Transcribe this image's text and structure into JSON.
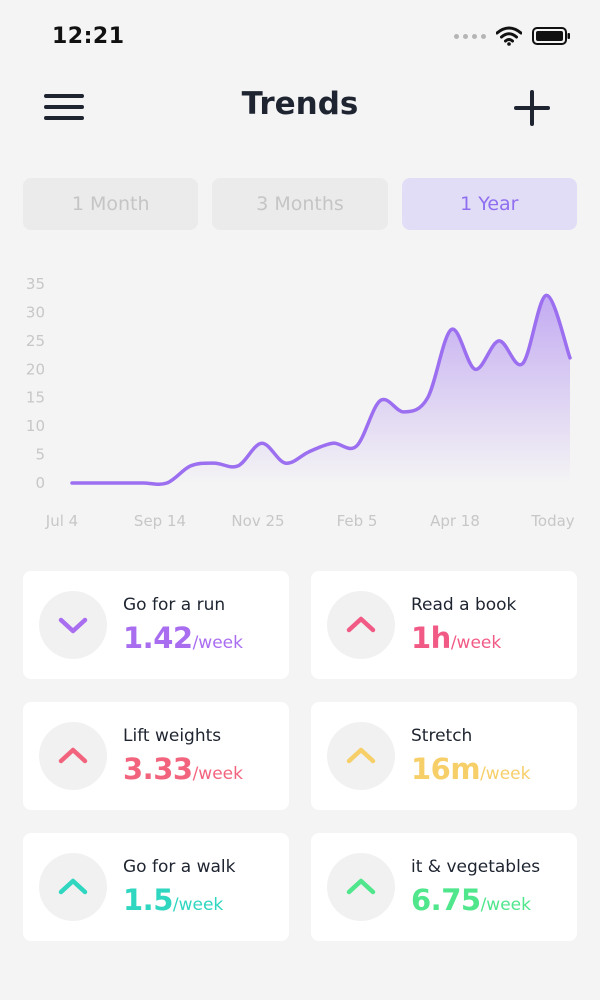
{
  "status": {
    "time": "12:21"
  },
  "header": {
    "title": "Trends"
  },
  "ranges": [
    {
      "label": "1 Month",
      "active": false
    },
    {
      "label": "3 Months",
      "active": false
    },
    {
      "label": "1 Year",
      "active": true
    }
  ],
  "colors": {
    "accent": "#9b6ff0",
    "pink": "#f25a86",
    "yellow": "#f7cf69",
    "teal": "#2fd6c0",
    "green": "#4fe68c"
  },
  "chart_data": {
    "type": "area",
    "x_ticks": [
      "Jul 4",
      "Sep 14",
      "Nov 25",
      "Feb 5",
      "Apr 18",
      "Today"
    ],
    "y_ticks": [
      0,
      5,
      10,
      15,
      20,
      25,
      30,
      35
    ],
    "ylim": [
      0,
      35
    ],
    "x": [
      0,
      1,
      2,
      3,
      4,
      5,
      6,
      7,
      8,
      9,
      10,
      11,
      12,
      13,
      14,
      15,
      16,
      17,
      18,
      19,
      20,
      21,
      22,
      23,
      24,
      25
    ],
    "values": [
      0,
      0,
      0,
      0,
      0,
      3,
      3.5,
      3,
      7,
      3.5,
      5.5,
      7,
      6.5,
      14.5,
      12.5,
      15,
      27,
      20,
      25,
      21,
      33,
      22
    ],
    "xlabel": "",
    "ylabel": "",
    "title": ""
  },
  "habits": [
    {
      "name": "Go for a run",
      "value": "1.42",
      "unit": "/week",
      "direction": "down",
      "color": "#a96df0"
    },
    {
      "name": "Read a book",
      "value": "1h",
      "unit": "/week",
      "direction": "up",
      "color": "#f25a86"
    },
    {
      "name": "Lift weights",
      "value": "3.33",
      "unit": "/week",
      "direction": "up",
      "color": "#f2647e"
    },
    {
      "name": "Stretch",
      "value": "16m",
      "unit": "/week",
      "direction": "up",
      "color": "#f7cf69"
    },
    {
      "name": "Go for a walk",
      "value": "1.5",
      "unit": "/week",
      "direction": "up",
      "color": "#2fd6c0"
    },
    {
      "name": "it & vegetables",
      "value": "6.75",
      "unit": "/week",
      "direction": "up",
      "color": "#4fe68c"
    }
  ]
}
